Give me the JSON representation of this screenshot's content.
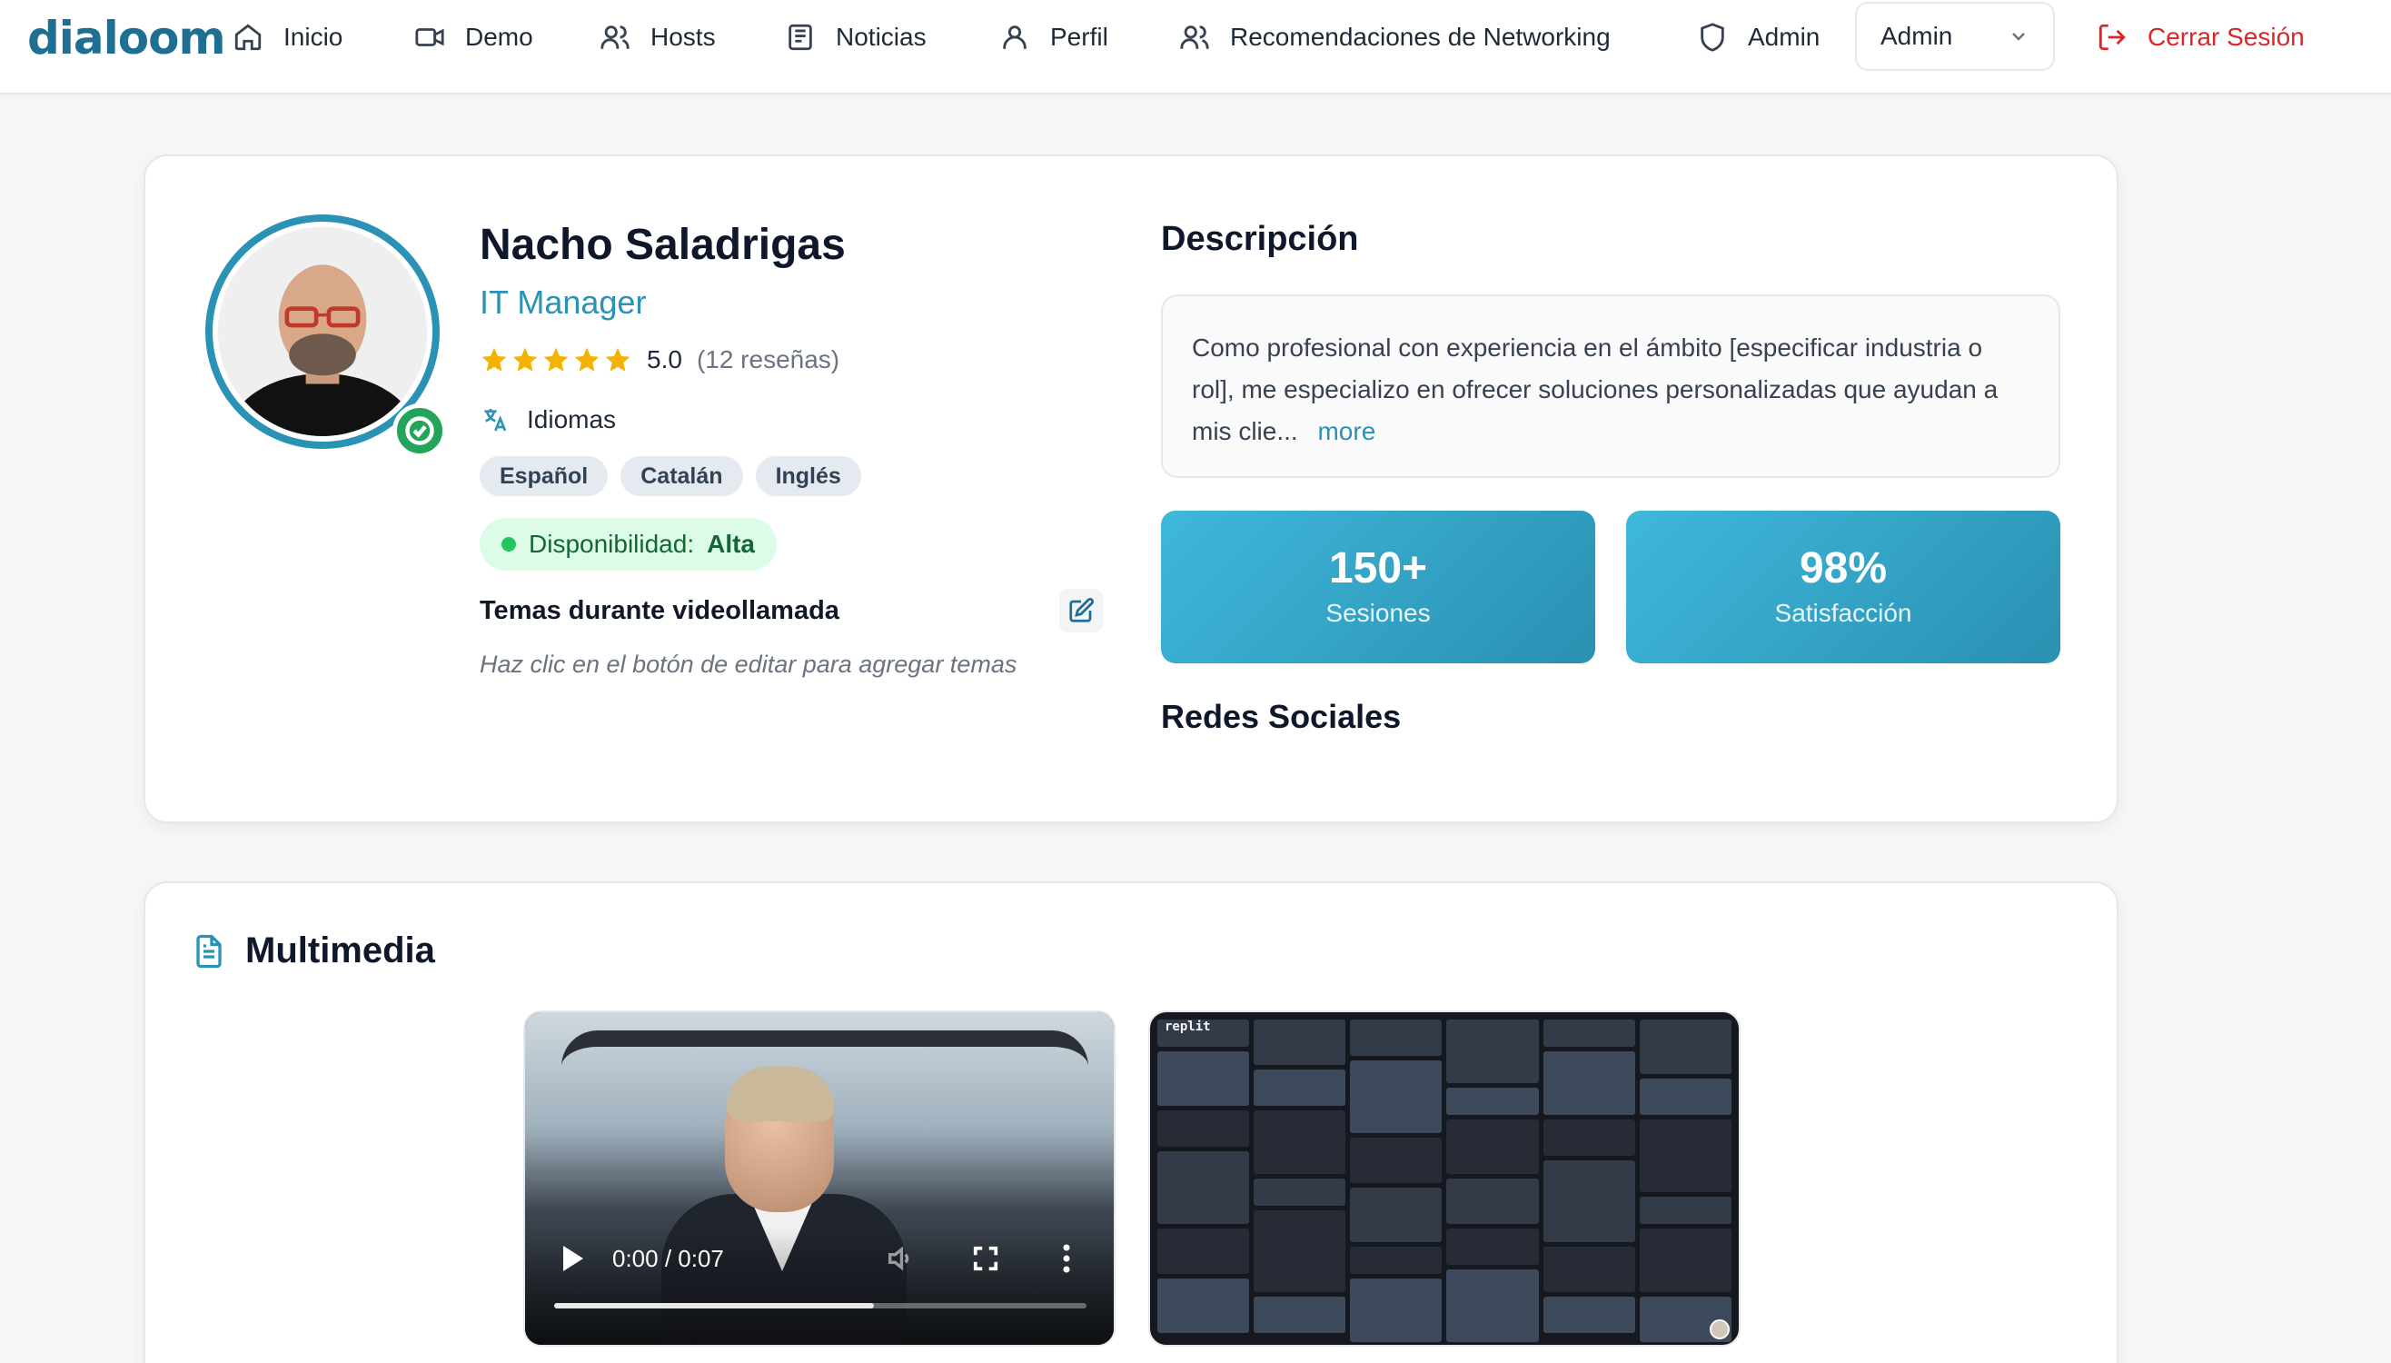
{
  "app": {
    "logo": "dialoom"
  },
  "nav": {
    "items": [
      {
        "label": "Inicio",
        "icon": "home-icon"
      },
      {
        "label": "Demo",
        "icon": "video-icon"
      },
      {
        "label": "Hosts",
        "icon": "users-icon"
      },
      {
        "label": "Noticias",
        "icon": "newspaper-icon"
      },
      {
        "label": "Perfil",
        "icon": "user-icon"
      },
      {
        "label": "Recomendaciones de Networking",
        "icon": "users-icon"
      },
      {
        "label": "Admin",
        "icon": "shield-icon"
      }
    ],
    "role_select": "Admin",
    "logout_label": "Cerrar Sesión",
    "logout_color": "#dc2626"
  },
  "profile": {
    "name": "Nacho Saladrigas",
    "role": "IT Manager",
    "rating": {
      "stars": 5,
      "value": "5.0",
      "reviews": "(12 reseñas)"
    },
    "languages_title": "Idiomas",
    "languages": [
      "Español",
      "Catalán",
      "Inglés"
    ],
    "availability": {
      "label": "Disponibilidad:",
      "value": "Alta"
    },
    "topics_title": "Temas durante videollamada",
    "topics_hint": "Haz clic en el botón de editar para agregar temas",
    "verified": true
  },
  "description": {
    "title": "Descripción",
    "text": "Como profesional con experiencia en el ámbito [especificar industria o rol], me especializo en ofrecer soluciones personalizadas que ayudan a mis clie...",
    "more_label": "more"
  },
  "stats": [
    {
      "value": "150+",
      "label": "Sesiones"
    },
    {
      "value": "98%",
      "label": "Satisfacción"
    }
  ],
  "social": {
    "title": "Redes Sociales"
  },
  "multimedia": {
    "title": "Multimedia",
    "video": {
      "time": "0:00 / 0:07",
      "progress_fraction": 0.6
    },
    "image_caption": "replit"
  },
  "colors": {
    "accent": "#2a92b4",
    "brand": "#1f6f93",
    "star": "#f5b301",
    "available": "#22c55e"
  }
}
